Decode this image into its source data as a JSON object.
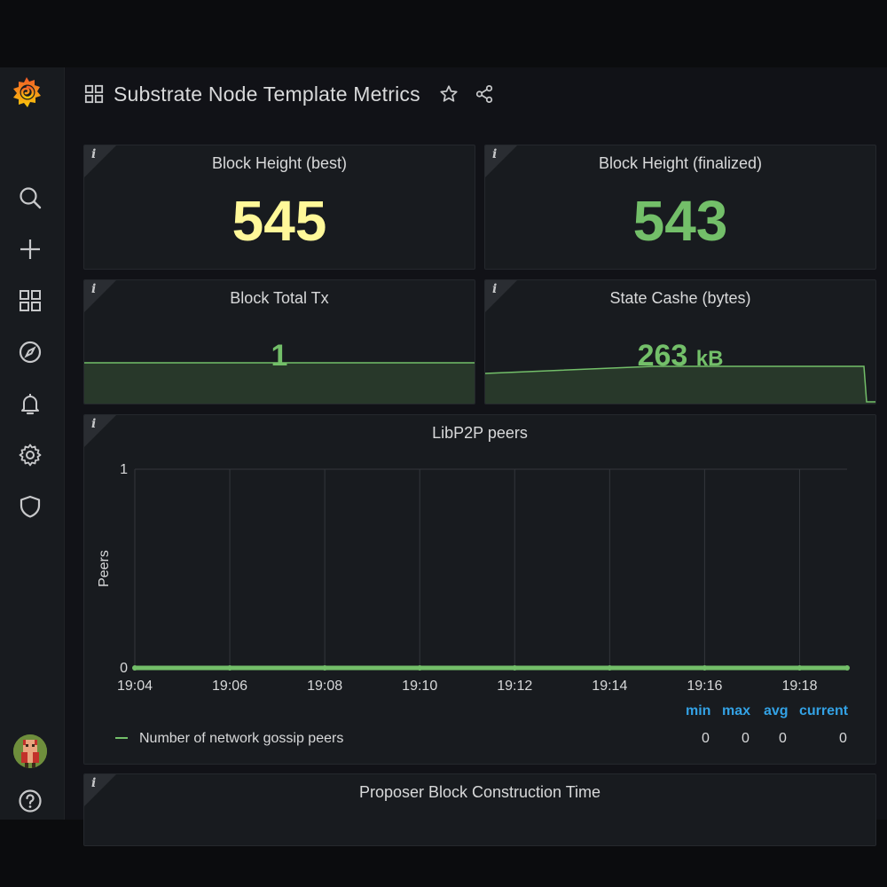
{
  "dashboard": {
    "title": "Substrate Node Template Metrics"
  },
  "sidebar": {
    "items": [
      "search-icon",
      "plus-icon",
      "dashboards-icon",
      "explore-icon",
      "alerting-icon",
      "configuration-icon",
      "shield-icon"
    ]
  },
  "panels": {
    "block_height_best": {
      "title": "Block Height (best)",
      "value": "545",
      "color": "#fff899"
    },
    "block_height_finalized": {
      "title": "Block Height (finalized)",
      "value": "543",
      "color": "#73bf69"
    },
    "block_total_tx": {
      "title": "Block Total Tx",
      "value": "1",
      "color": "#73bf69"
    },
    "state_cache": {
      "title": "State Cashe (bytes)",
      "value": "263",
      "unit": "kB",
      "color": "#73bf69"
    },
    "libp2p_peers": {
      "title": "LibP2P peers",
      "legend": {
        "headers": [
          "min",
          "max",
          "avg",
          "current"
        ],
        "series_label": "Number of network gossip peers",
        "values": [
          "0",
          "0",
          "0",
          "0"
        ]
      }
    },
    "proposer": {
      "title": "Proposer Block Construction Time"
    }
  },
  "chart_data": {
    "type": "line",
    "title": "LibP2P peers",
    "ylabel": "Peers",
    "xlabel": "",
    "x_ticks": [
      "19:04",
      "19:06",
      "19:08",
      "19:10",
      "19:12",
      "19:14",
      "19:16",
      "19:18"
    ],
    "y_ticks": [
      "0",
      "1"
    ],
    "ylim": [
      0,
      1
    ],
    "series": [
      {
        "name": "Number of network gossip peers",
        "color": "#73bf69",
        "x": [
          "19:04",
          "19:06",
          "19:08",
          "19:10",
          "19:12",
          "19:14",
          "19:16",
          "19:18",
          "19:19"
        ],
        "values": [
          0,
          0,
          0,
          0,
          0,
          0,
          0,
          0,
          0
        ]
      }
    ]
  }
}
